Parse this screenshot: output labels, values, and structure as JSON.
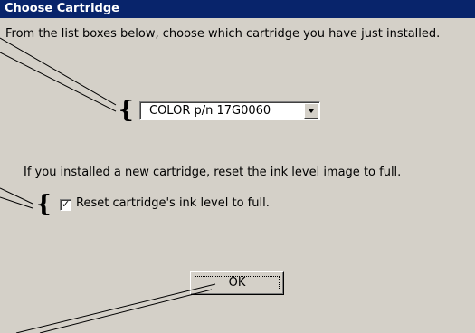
{
  "dialog": {
    "title": "Choose Cartridge",
    "instruction": "From the list boxes below, choose which cartridge you have just installed.",
    "cartridge_select": {
      "value": "COLOR p/n 17G0060"
    },
    "reset_instruction": "If you installed a new cartridge, reset the ink level image to full.",
    "reset_checkbox": {
      "label": "Reset cartridge's ink level to full.",
      "checked": true
    },
    "ok_label": "OK"
  },
  "colors": {
    "dialog_face": "#d4d0c8",
    "title_bar": "#08246b",
    "title_text": "#ffffff"
  },
  "icons": {
    "dropdown": "chevron-down-icon",
    "checkmark": "check-icon",
    "brace": "left-brace-icon"
  }
}
